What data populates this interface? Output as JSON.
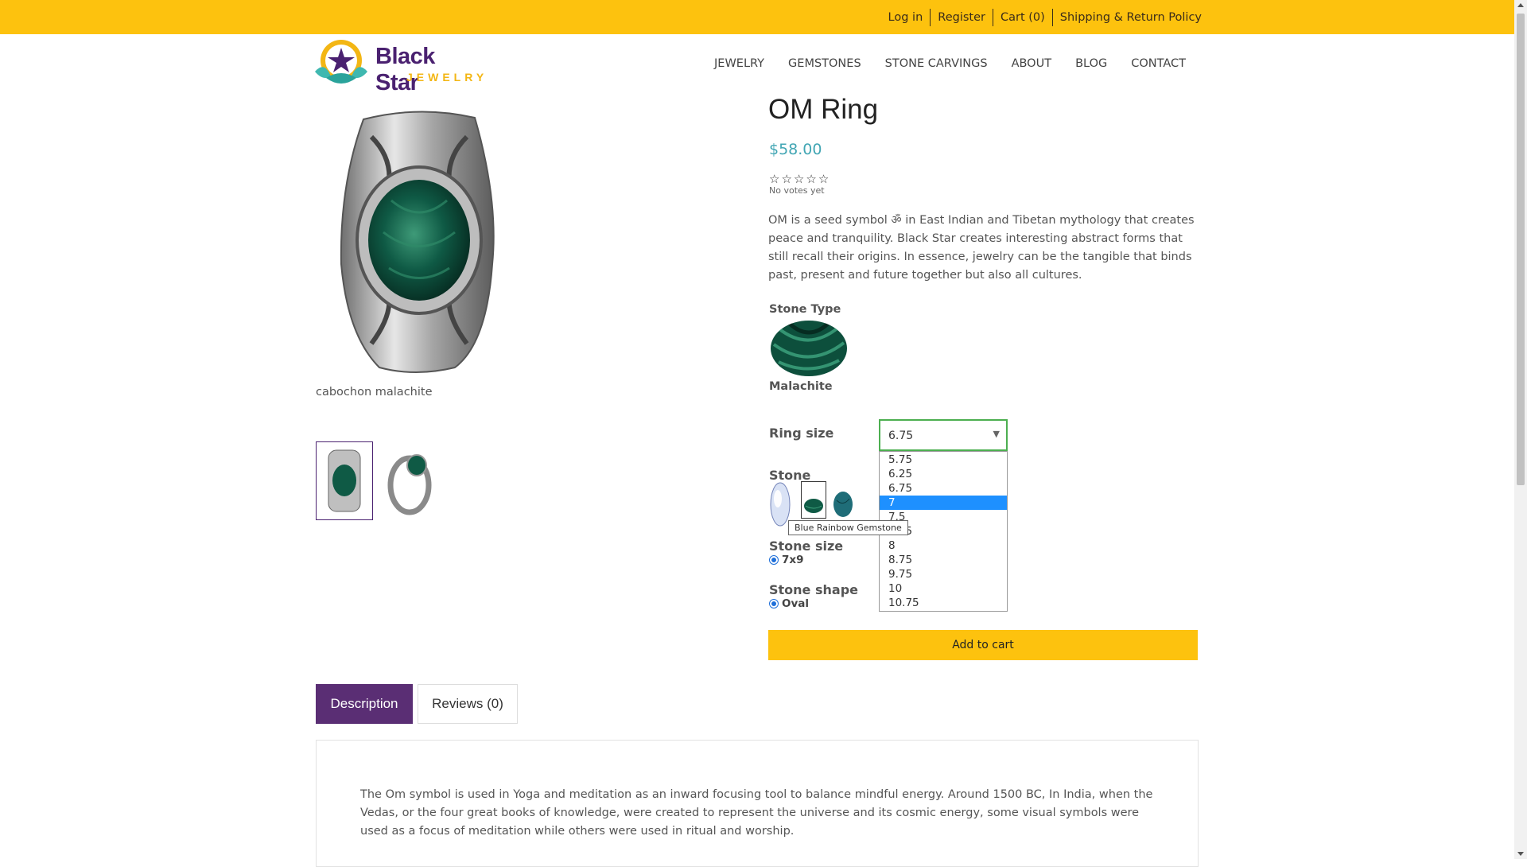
{
  "topbar": {
    "links": [
      "Log in",
      "Register",
      "Cart (0)",
      "Shipping & Return Policy"
    ]
  },
  "logo": {
    "line1": "Black Star",
    "line2": "JEWELRY"
  },
  "nav": {
    "items": [
      "JEWELRY",
      "GEMSTONES",
      "STONE CARVINGS",
      "ABOUT",
      "BLOG",
      "CONTACT"
    ]
  },
  "gallery": {
    "caption": "cabochon malachite"
  },
  "product": {
    "title": "OM Ring",
    "price": "$58.00",
    "rating": {
      "stars": 0,
      "max": 5,
      "label": "No votes yet"
    },
    "description": "OM is a seed symbol ॐ in East Indian and Tibetan mythology that creates peace and tranquility. Black Star creates interesting abstract forms that still recall their origins. In essence, jewelry can be the tangible that binds past, present and future together but also all cultures."
  },
  "options": {
    "stone_type_label": "Stone Type",
    "stone_type_value": "Malachite",
    "ring_size_label": "Ring size",
    "ring_size_selected": "6.75",
    "ring_size_options": [
      "5.75",
      "6.25",
      "6.75",
      "7",
      "7.5",
      "7.75",
      "8",
      "8.75",
      "9.75",
      "10",
      "10.75"
    ],
    "ring_size_highlighted": "7",
    "stone_label": "Stone",
    "stone_tooltip": "Blue Rainbow Gemstone",
    "stone_size_label": "Stone size",
    "stone_size_value": "7x9",
    "stone_shape_label": "Stone shape",
    "stone_shape_value": "Oval"
  },
  "cart": {
    "button_label": "Add to cart"
  },
  "tabs": [
    "Description",
    "Reviews (0)"
  ],
  "description_panel": {
    "text": "The Om symbol is used in Yoga and meditation as an inward focusing tool to balance mindful energy. Around 1500 BC, In India, when the Vedas, or the four great books of knowledge, were created to represent the universe and its cosmic energy, some visual symbols were used as a focus of meditation while others were used in ritual and worship."
  },
  "colors": {
    "topbar": "#fdc20e",
    "brand_purple": "#4a2170",
    "price": "#42a6b4",
    "tab_active": "#5a2e74",
    "select_focus": "#4caf50",
    "dropdown_highlight": "#1e90ff"
  },
  "icons": [
    "star-outline-icon",
    "dropdown-arrow-icon",
    "radio-selected-icon",
    "scroll-up-icon",
    "scroll-down-icon"
  ]
}
